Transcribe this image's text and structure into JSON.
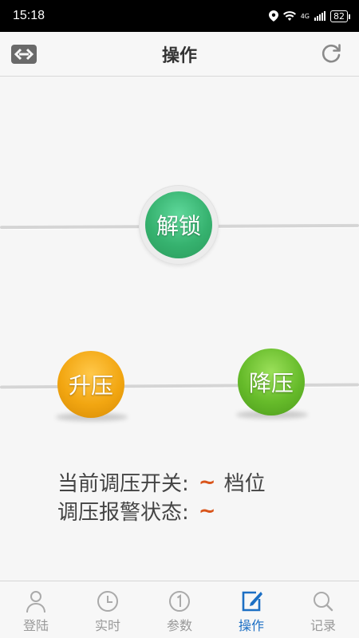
{
  "status_bar": {
    "time": "15:18",
    "network": "4G",
    "battery": "82"
  },
  "header": {
    "title": "操作"
  },
  "buttons": {
    "unlock": "解锁",
    "boost": "升压",
    "lower": "降压"
  },
  "info": {
    "switch_label": "当前调压开关:",
    "switch_value": "~",
    "switch_unit": "档位",
    "alarm_label": "调压报警状态:",
    "alarm_value": "~"
  },
  "nav": {
    "items": [
      {
        "label": "登陆",
        "icon": "user-icon"
      },
      {
        "label": "实时",
        "icon": "clock-icon"
      },
      {
        "label": "参数",
        "icon": "number-icon"
      },
      {
        "label": "操作",
        "icon": "edit-icon",
        "active": true
      },
      {
        "label": "记录",
        "icon": "search-icon"
      }
    ]
  },
  "colors": {
    "active_tab": "#1c6fc4",
    "unlock": "#36b26f",
    "boost": "#f2a611",
    "lower": "#66bb2a",
    "tilde": "#d9541a"
  }
}
